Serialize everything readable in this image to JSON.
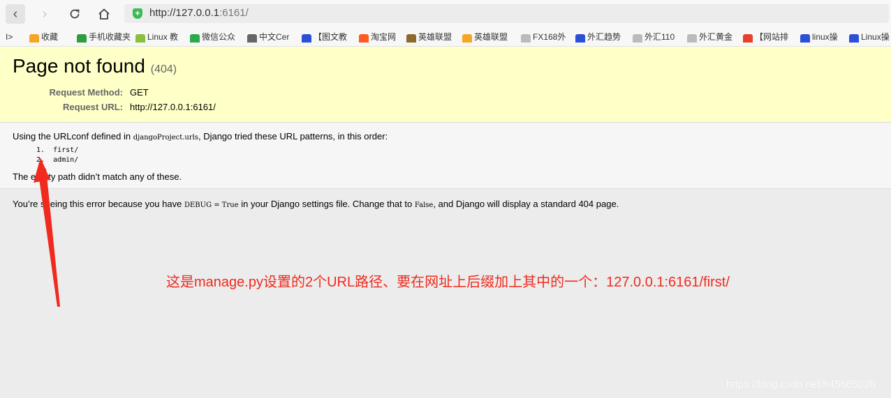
{
  "browser": {
    "url_host": "http://127.0.0.1",
    "url_rest": ":6161/",
    "bookmarks": [
      {
        "label": "收藏",
        "color": "#f5a623"
      },
      {
        "label": "手机收藏夹",
        "color": "#2e9c40"
      },
      {
        "label": "Linux 教",
        "color": "#8bbf3f"
      },
      {
        "label": "微信公众",
        "color": "#2ea94a"
      },
      {
        "label": "中文Cer",
        "color": "#666666"
      },
      {
        "label": "【图文教",
        "color": "#2b4fd6"
      },
      {
        "label": "淘宝网",
        "color": "#ff5a1f"
      },
      {
        "label": "英雄联盟",
        "color": "#8b6a2b"
      },
      {
        "label": "英雄联盟",
        "color": "#f5a623"
      },
      {
        "label": "FX168外",
        "color": "#bbbbbb"
      },
      {
        "label": "外汇趋势",
        "color": "#2b4fd6"
      },
      {
        "label": "外汇110",
        "color": "#bbbbbb"
      },
      {
        "label": "外汇黄金",
        "color": "#bbbbbb"
      },
      {
        "label": "【网站排",
        "color": "#e8402a"
      },
      {
        "label": "linux操",
        "color": "#2b4fd6"
      },
      {
        "label": "Linux操",
        "color": "#2b4fd6"
      }
    ]
  },
  "error": {
    "title": "Page not found",
    "code": "(404)",
    "request_method_label": "Request Method:",
    "request_method": "GET",
    "request_url_label": "Request URL:",
    "request_url": "http://127.0.0.1:6161/",
    "urlconf_prefix": "Using the URLconf defined in",
    "urlconf_module": "djangoProject.urls",
    "urlconf_suffix": ", Django tried these URL patterns, in this order:",
    "patterns": [
      "first/",
      "admin/"
    ],
    "empty_path_msg": "The empty path didn’t match any of these.",
    "debug_prefix": "You’re seeing this error because you have",
    "debug_setting": "DEBUG = True",
    "debug_middle": "in your Django settings file. Change that to",
    "debug_false": "False",
    "debug_suffix": ", and Django will display a standard 404 page."
  },
  "annotation": {
    "note": "这是manage.py设置的2个URL路径、要在网址上后缀加上其中的一个：127.0.0.1:6161/first/",
    "color": "#f02a1e"
  },
  "watermark": "https://blog.csdn.net/h4568502h"
}
